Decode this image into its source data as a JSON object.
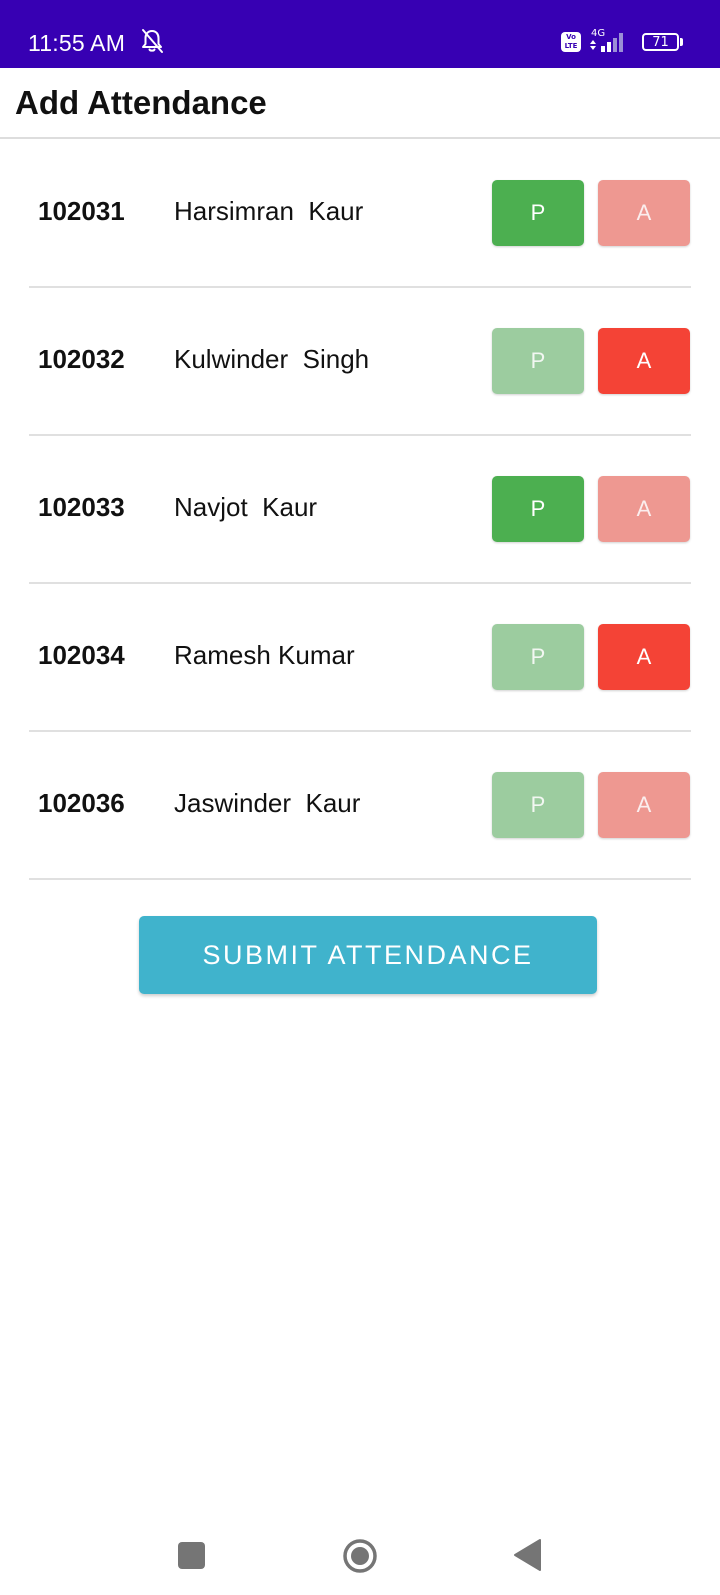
{
  "status_bar": {
    "time": "11:55 AM",
    "volte": "Vo LTE",
    "network": "4G",
    "battery": "71"
  },
  "header": {
    "title": "Add Attendance"
  },
  "students": [
    {
      "roll": "102031",
      "name": "Harsimran  Kaur",
      "status": "present"
    },
    {
      "roll": "102032",
      "name": "Kulwinder  Singh",
      "status": "absent"
    },
    {
      "roll": "102033",
      "name": "Navjot  Kaur",
      "status": "present"
    },
    {
      "roll": "102034",
      "name": "Ramesh Kumar",
      "status": "absent"
    },
    {
      "roll": "102036",
      "name": "Jaswinder  Kaur",
      "status": "none"
    }
  ],
  "buttons": {
    "present_label": "P",
    "absent_label": "A",
    "submit_label": "SUBMIT ATTENDANCE"
  },
  "colors": {
    "status_bar": "#3700b3",
    "present_active": "#4caf50",
    "present_inactive": "#9ccc9f",
    "absent_active": "#f44336",
    "absent_inactive": "#ee9891",
    "submit": "#40b3cc"
  },
  "icons": {
    "bell": "bell-off-icon",
    "signal": "signal-icon",
    "battery": "battery-icon",
    "nav_recent": "square-icon",
    "nav_home": "circle-icon",
    "nav_back": "triangle-back-icon"
  }
}
